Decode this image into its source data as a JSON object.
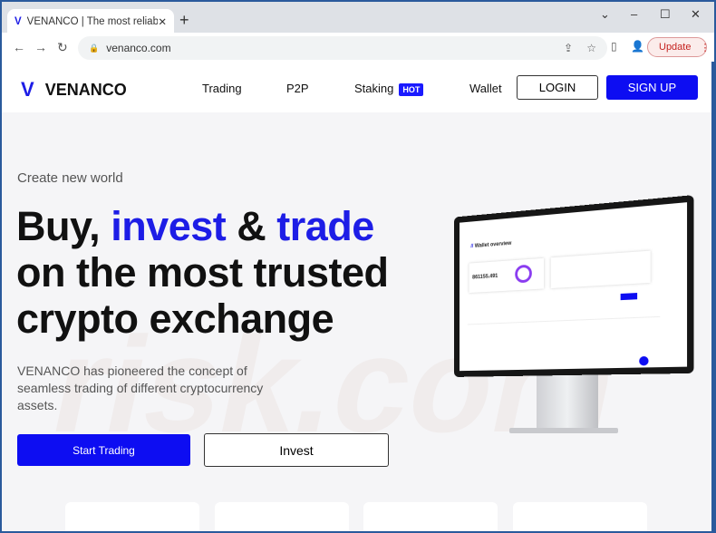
{
  "browser": {
    "tab_title": "VENANCO | The most reliable pla",
    "url": "venanco.com",
    "update_label": "Update"
  },
  "nav": {
    "brand": "VENANCO",
    "links": [
      "Trading",
      "P2P",
      "Staking",
      "Wallet"
    ],
    "hot_badge": "HOT",
    "login": "LOGIN",
    "signup": "SIGN UP"
  },
  "hero": {
    "subtitle": "Create new world",
    "title_line1_a": "Buy, ",
    "title_line1_b": "invest",
    "title_line1_c": " & ",
    "title_line1_d": "trade",
    "title_line2": "on the most trusted",
    "title_line3": "crypto exchange",
    "description": "VENANCO has pioneered the concept of seamless trading of different cryptocurrency assets.",
    "start_trading": "Start Trading",
    "invest": "Invest"
  },
  "monitor": {
    "heading": "Wallet overview",
    "balance": "861155.491"
  },
  "colors": {
    "accent": "#0d0df2"
  }
}
